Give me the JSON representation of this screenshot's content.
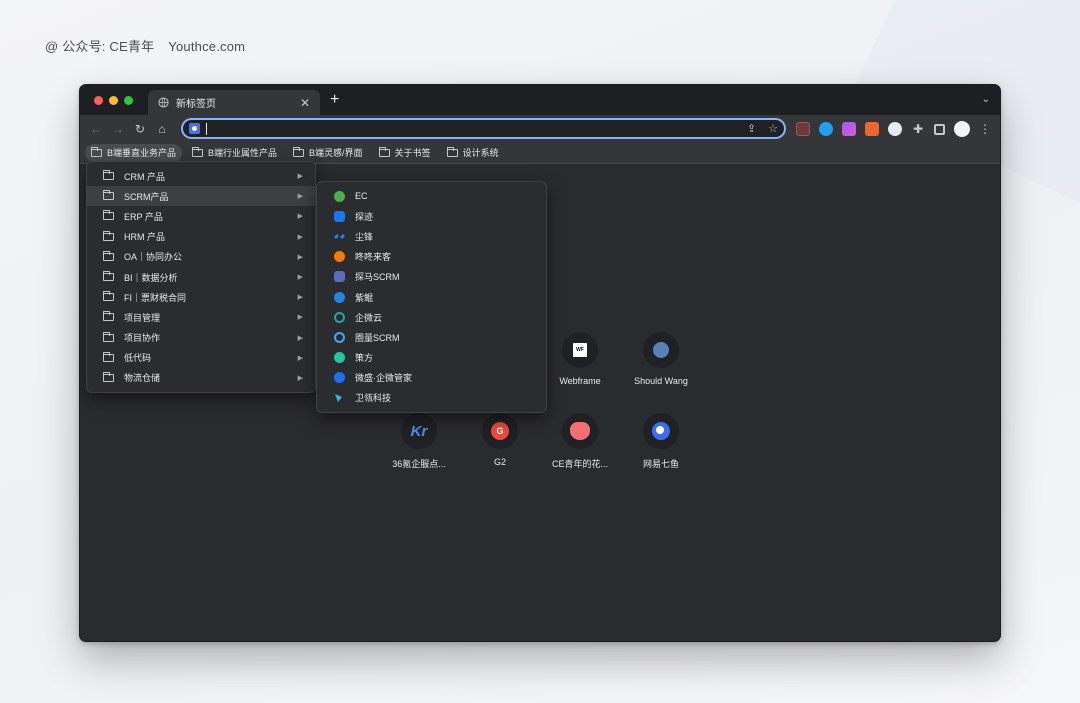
{
  "watermark": {
    "account": "@ 公众号: CE青年",
    "site": "Youthce.com"
  },
  "browser": {
    "tab": {
      "title": "新标签页",
      "close": "✕"
    },
    "new_tab": "+",
    "tab_menu": "⌄",
    "nav": {
      "back": "←",
      "forward": "→",
      "reload": "↻",
      "home": "⌂"
    },
    "omnibox": {
      "value": "",
      "share": "⇪",
      "star": "☆"
    },
    "extensions": [
      "ext-reader-icon",
      "ext-blue-circle-icon",
      "ext-purple-gradient-icon",
      "ext-orange-icon",
      "ext-openai-icon",
      "puzzle-icon",
      "sidepanel-icon",
      "profile-avatar",
      "kebab-menu-icon"
    ],
    "puzzle_glyph": "✚",
    "kebab_glyph": "⋮"
  },
  "bookmarks": [
    {
      "label": "B端垂直业务产品",
      "active": true
    },
    {
      "label": "B端行业属性产品"
    },
    {
      "label": "B端灵感/界面"
    },
    {
      "label": "关于书签"
    },
    {
      "label": "设计系统"
    }
  ],
  "menu_main": [
    {
      "label": "CRM 产品"
    },
    {
      "label": "SCRM产品",
      "highlighted": true
    },
    {
      "label": "ERP 产品"
    },
    {
      "label": "HRM 产品"
    },
    {
      "label": "OA｜协同办公"
    },
    {
      "label": "BI｜数据分析"
    },
    {
      "label": "FI｜票财税合同"
    },
    {
      "label": "项目管理"
    },
    {
      "label": "项目协作"
    },
    {
      "label": "低代码"
    },
    {
      "label": "物流仓储"
    }
  ],
  "menu_arrow": "▶",
  "menu_sub": [
    {
      "label": "EC",
      "color": "#4caf50"
    },
    {
      "label": "探迹",
      "color": "#1677ff"
    },
    {
      "label": "尘锋",
      "color": "#1e88e5"
    },
    {
      "label": "咚咚来客",
      "color": "#f57c00"
    },
    {
      "label": "探马SCRM",
      "color": "#5c6bc0"
    },
    {
      "label": "紫鲲",
      "color": "#1e88e5"
    },
    {
      "label": "企微云",
      "color": "#26a69a"
    },
    {
      "label": "圈量SCRM",
      "color": "#42a5f5"
    },
    {
      "label": "策方",
      "color": "#26c6a0"
    },
    {
      "label": "微盛·企微管家",
      "color": "#1e6ff5"
    },
    {
      "label": "卫瓴科技",
      "color": "#29b6f6"
    }
  ],
  "shortcuts": [
    {
      "label": "Webframe",
      "icon": "webframe-icon",
      "glyph": "WF"
    },
    {
      "label": "Should Wang",
      "icon": "avatar-icon"
    },
    {
      "label": "36氪企服点...",
      "icon": "kr-icon",
      "glyph": "Kr"
    },
    {
      "label": "G2",
      "icon": "g2-icon",
      "glyph": "G"
    },
    {
      "label": "CE青年的花...",
      "icon": "ce-icon"
    },
    {
      "label": "网易七鱼",
      "icon": "qiyu-icon"
    }
  ]
}
